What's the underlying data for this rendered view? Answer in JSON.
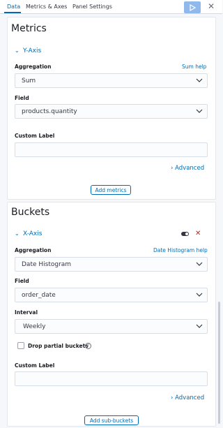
{
  "tabs": [
    {
      "label": "Data"
    },
    {
      "label": "Metrics & Axes"
    },
    {
      "label": "Panel Settings"
    }
  ],
  "metrics": {
    "title": "Metrics",
    "y_axis": {
      "title": "Y-Axis",
      "aggregation_label": "Aggregation",
      "aggregation_help": "Sum help",
      "aggregation_value": "Sum",
      "field_label": "Field",
      "field_value": "products.quantity",
      "custom_label": "Custom Label",
      "custom_value": "",
      "advanced": "Advanced"
    },
    "add_button": "Add metrics"
  },
  "buckets": {
    "title": "Buckets",
    "x_axis": {
      "title": "X-Axis",
      "aggregation_label": "Aggregation",
      "aggregation_help": "Date Histogram help",
      "aggregation_value": "Date Histogram",
      "field_label": "Field",
      "field_value": "order_date",
      "interval_label": "Interval",
      "interval_value": "Weekly",
      "drop_partial_label": "Drop partial buckets",
      "drop_partial_checked": false,
      "custom_label": "Custom Label",
      "custom_value": "",
      "advanced": "Advanced"
    },
    "add_button": "Add sub-buckets"
  },
  "colors": {
    "accent": "#006bb4",
    "run_button": "#8fb9ec",
    "danger": "#bd271e"
  },
  "icons": {
    "run": "play-icon",
    "close": "close-icon",
    "chevron": "chevron-down-icon",
    "advanced_chevron": "chevron-right-icon",
    "toggle": "toggle-icon",
    "remove": "remove-icon",
    "help": "question-icon"
  }
}
